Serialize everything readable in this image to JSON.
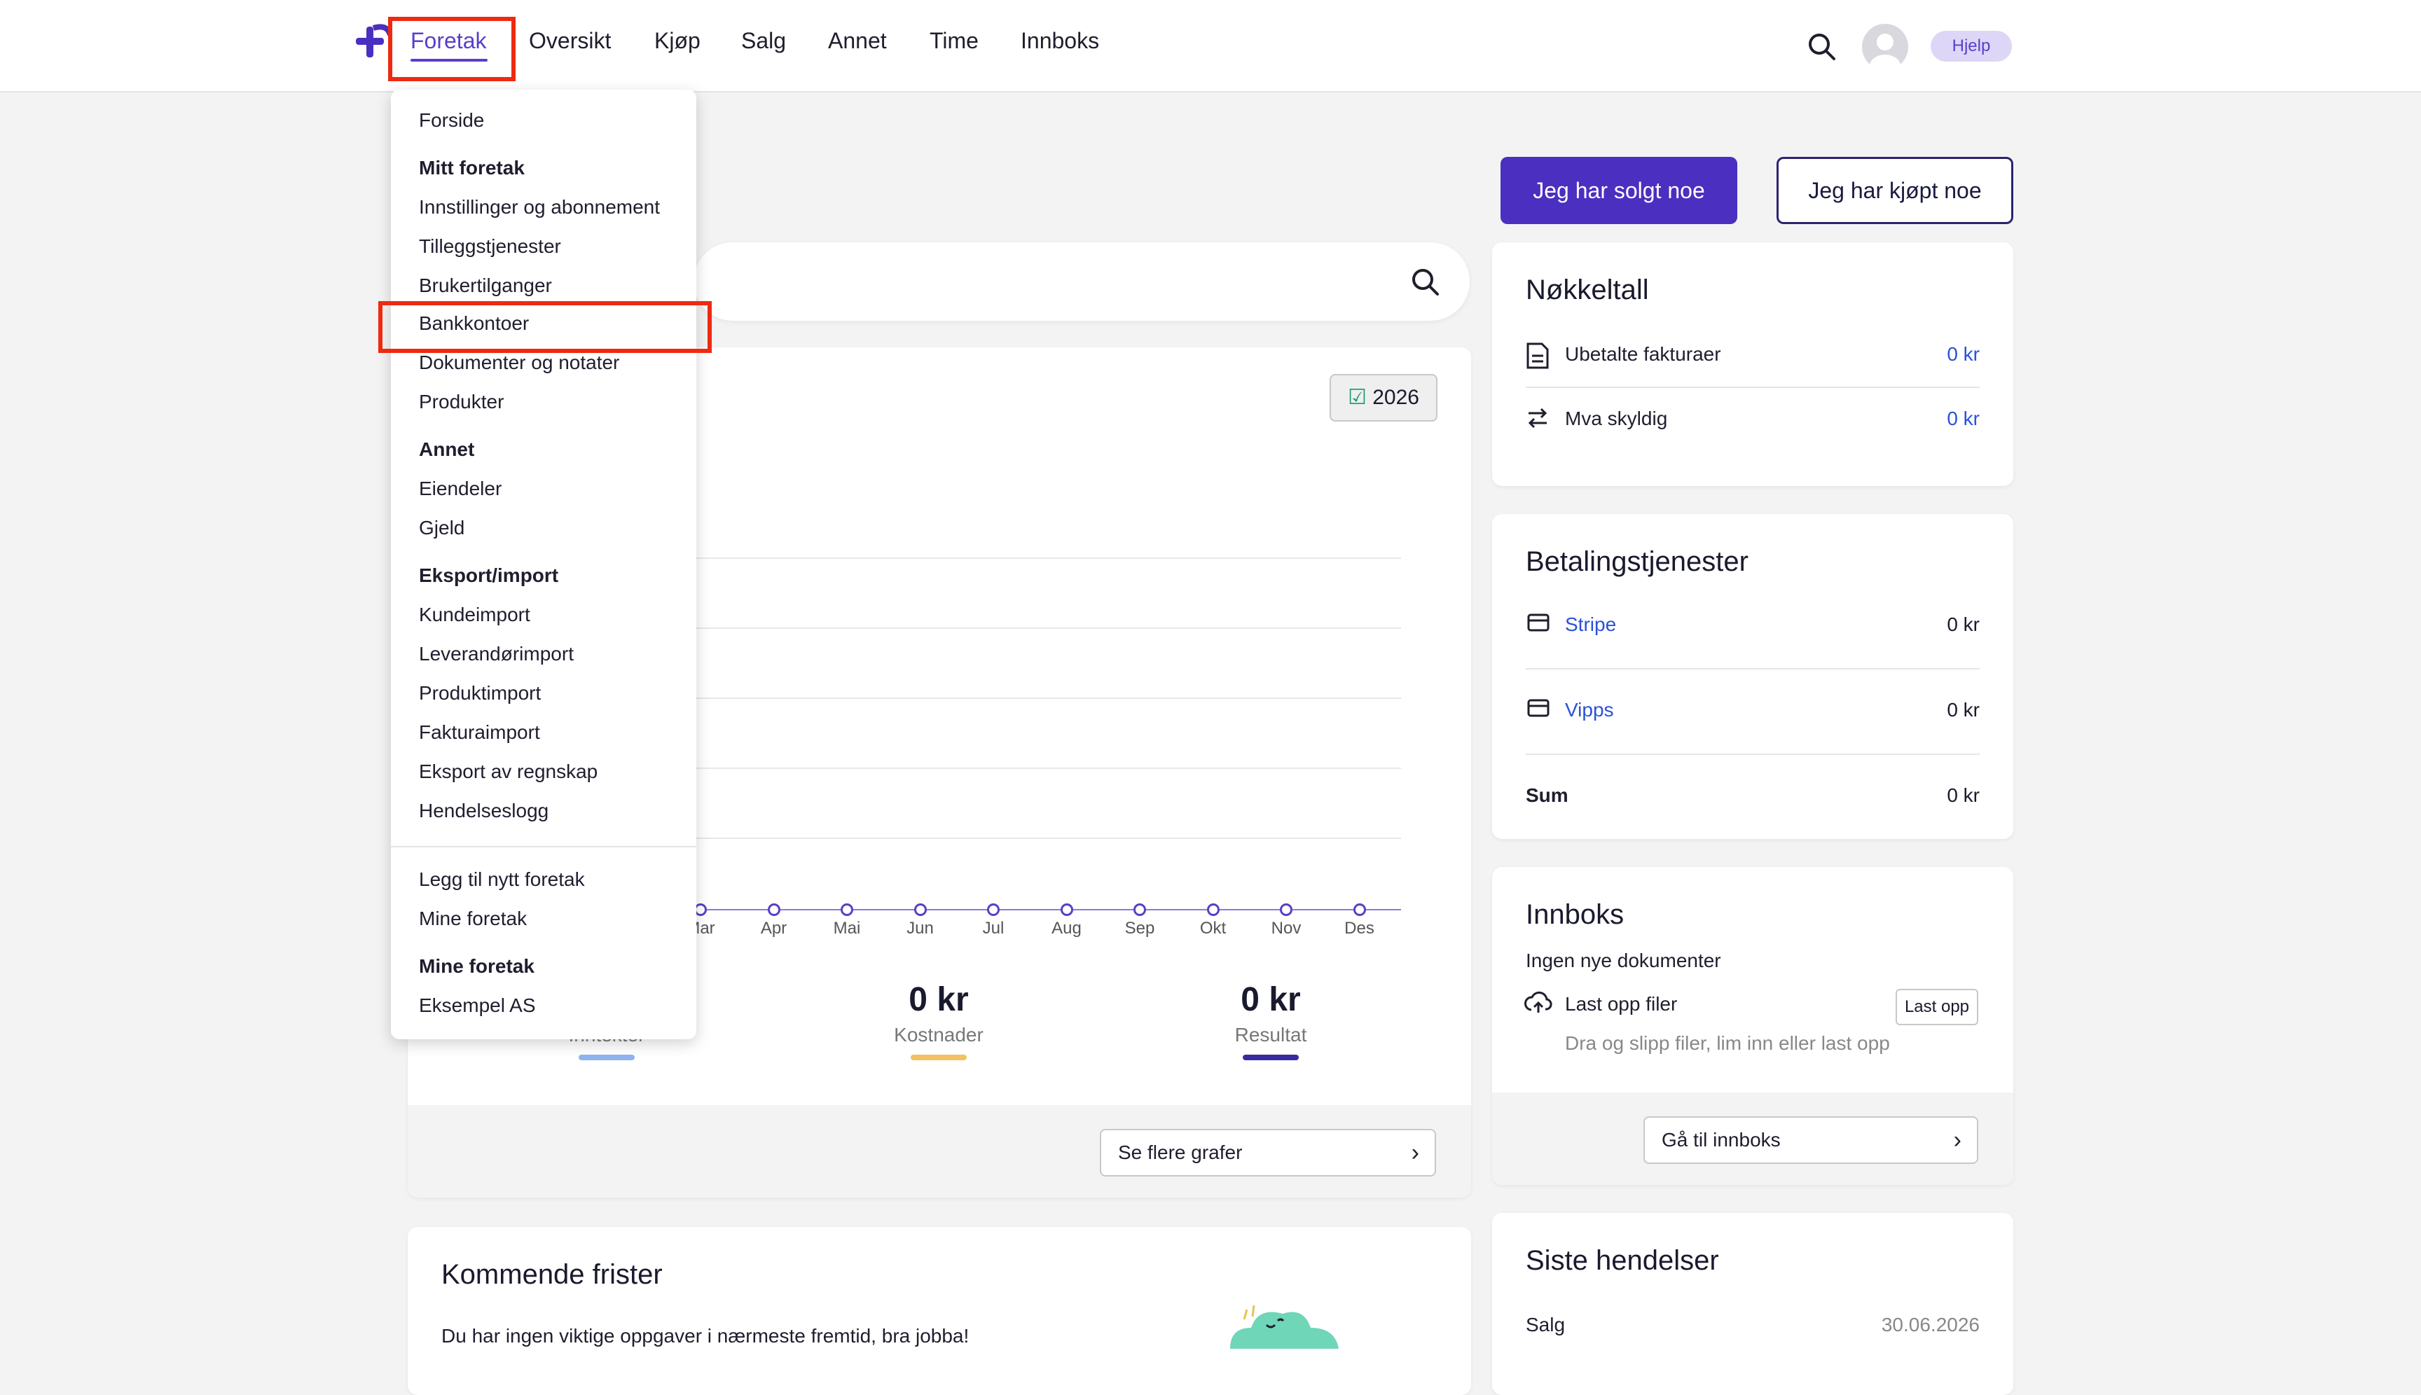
{
  "nav": {
    "items": [
      "Foretak",
      "Oversikt",
      "Kjøp",
      "Salg",
      "Annet",
      "Time",
      "Innboks"
    ],
    "help": "Hjelp"
  },
  "actions": {
    "sold": "Jeg har solgt noe",
    "bought": "Jeg har kjøpt noe"
  },
  "dropdown": {
    "forside": "Forside",
    "mitt_foretak_heading": "Mitt foretak",
    "mitt_foretak": [
      "Innstillinger og abonnement",
      "Tilleggstjenester",
      "Brukertilganger",
      "Bankkontoer",
      "Dokumenter og notater",
      "Produkter"
    ],
    "annet_heading": "Annet",
    "annet": [
      "Eiendeler",
      "Gjeld"
    ],
    "eksport_heading": "Eksport/import",
    "eksport": [
      "Kundeimport",
      "Leverandørimport",
      "Produktimport",
      "Fakturaimport",
      "Eksport av regnskap",
      "Hendelseslogg"
    ],
    "footer": [
      "Legg til nytt foretak",
      "Mine foretak"
    ],
    "mine_foretak_heading": "Mine foretak",
    "companies": [
      "Eksempel AS"
    ]
  },
  "chart": {
    "year": "2026",
    "months_visible": [
      "Mar",
      "Apr",
      "Mai",
      "Jun",
      "Jul",
      "Aug",
      "Sep",
      "Okt",
      "Nov",
      "Des"
    ],
    "kpis": {
      "costs_value": "0 kr",
      "costs_label": "Kostnader",
      "result_value": "0 kr",
      "result_label": "Resultat",
      "income_label": "Inntekter"
    },
    "more_graphs": "Se flere grafer"
  },
  "key_figures": {
    "title": "Nøkkeltall",
    "unpaid_label": "Ubetalte fakturaer",
    "unpaid_value": "0 kr",
    "vat_label": "Mva skyldig",
    "vat_value": "0 kr"
  },
  "payments": {
    "title": "Betalingstjenester",
    "stripe_label": "Stripe",
    "stripe_value": "0 kr",
    "vipps_label": "Vipps",
    "vipps_value": "0 kr",
    "sum_label": "Sum",
    "sum_value": "0 kr"
  },
  "inbox": {
    "title": "Innboks",
    "empty": "Ingen nye dokumenter",
    "upload_label": "Last opp filer",
    "upload_button": "Last opp",
    "upload_hint": "Dra og slipp filer, lim inn eller last opp",
    "goto": "Gå til innboks"
  },
  "deadlines": {
    "title": "Kommende frister",
    "empty": "Du har ingen viktige oppgaver i nærmeste fremtid, bra jobba!"
  },
  "events": {
    "title": "Siste hendelser",
    "first_label": "Salg",
    "first_date": "30.06.2026"
  },
  "colors": {
    "brand": "#5b3ec9",
    "primary_button": "#4a2fc0",
    "link": "#2a52d8",
    "highlight": "#ee2a10",
    "income_bar": "#8fb3ef",
    "costs_bar": "#f4c160",
    "result_bar": "#3a2aa0"
  }
}
